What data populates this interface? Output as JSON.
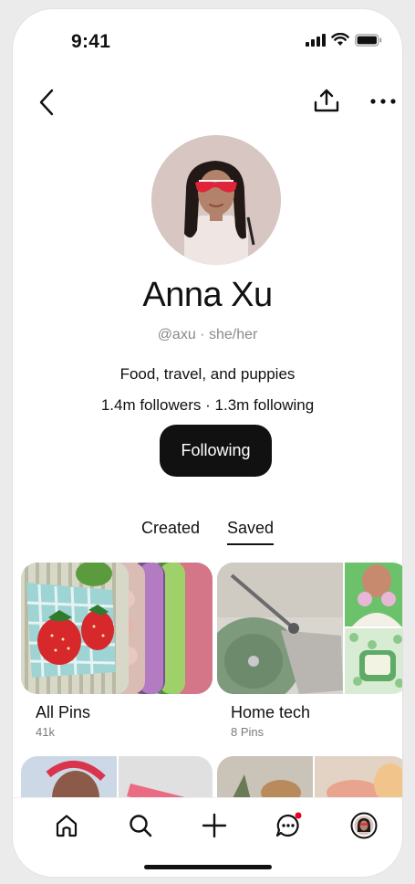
{
  "status_bar": {
    "time": "9:41"
  },
  "profile": {
    "name": "Anna Xu",
    "handle": "@axu · she/her",
    "bio": "Food, travel, and puppies",
    "stats": "1.4m followers · 1.3m following",
    "follow_button": "Following"
  },
  "tabs": [
    {
      "label": "Created",
      "active": false
    },
    {
      "label": "Saved",
      "active": true
    }
  ],
  "boards": [
    {
      "title": "All Pins",
      "count": "41k"
    },
    {
      "title": "Home tech",
      "count": "8 Pins"
    }
  ],
  "bottom_nav": [
    {
      "icon": "home-icon"
    },
    {
      "icon": "search-icon"
    },
    {
      "icon": "plus-icon"
    },
    {
      "icon": "messages-icon",
      "badge": true
    },
    {
      "icon": "profile-avatar-icon"
    }
  ],
  "colors": {
    "button_bg": "#111111",
    "notification_dot": "#e60023",
    "muted_text": "#8a8a8a"
  }
}
